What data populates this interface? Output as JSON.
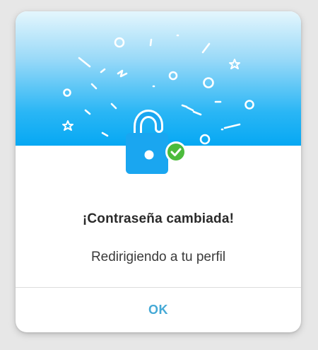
{
  "dialog": {
    "title": "¡Contraseña cambiada!",
    "message": "Redirigiendo a tu perfil",
    "ok_label": "OK"
  },
  "icons": {
    "illustration": "padlock-unlocked-icon",
    "badge": "check-circle-icon"
  },
  "colors": {
    "accent": "#06a8f3",
    "lock": "#1aa6f0",
    "success": "#4cbb3c",
    "button_text": "#45a9d6"
  }
}
